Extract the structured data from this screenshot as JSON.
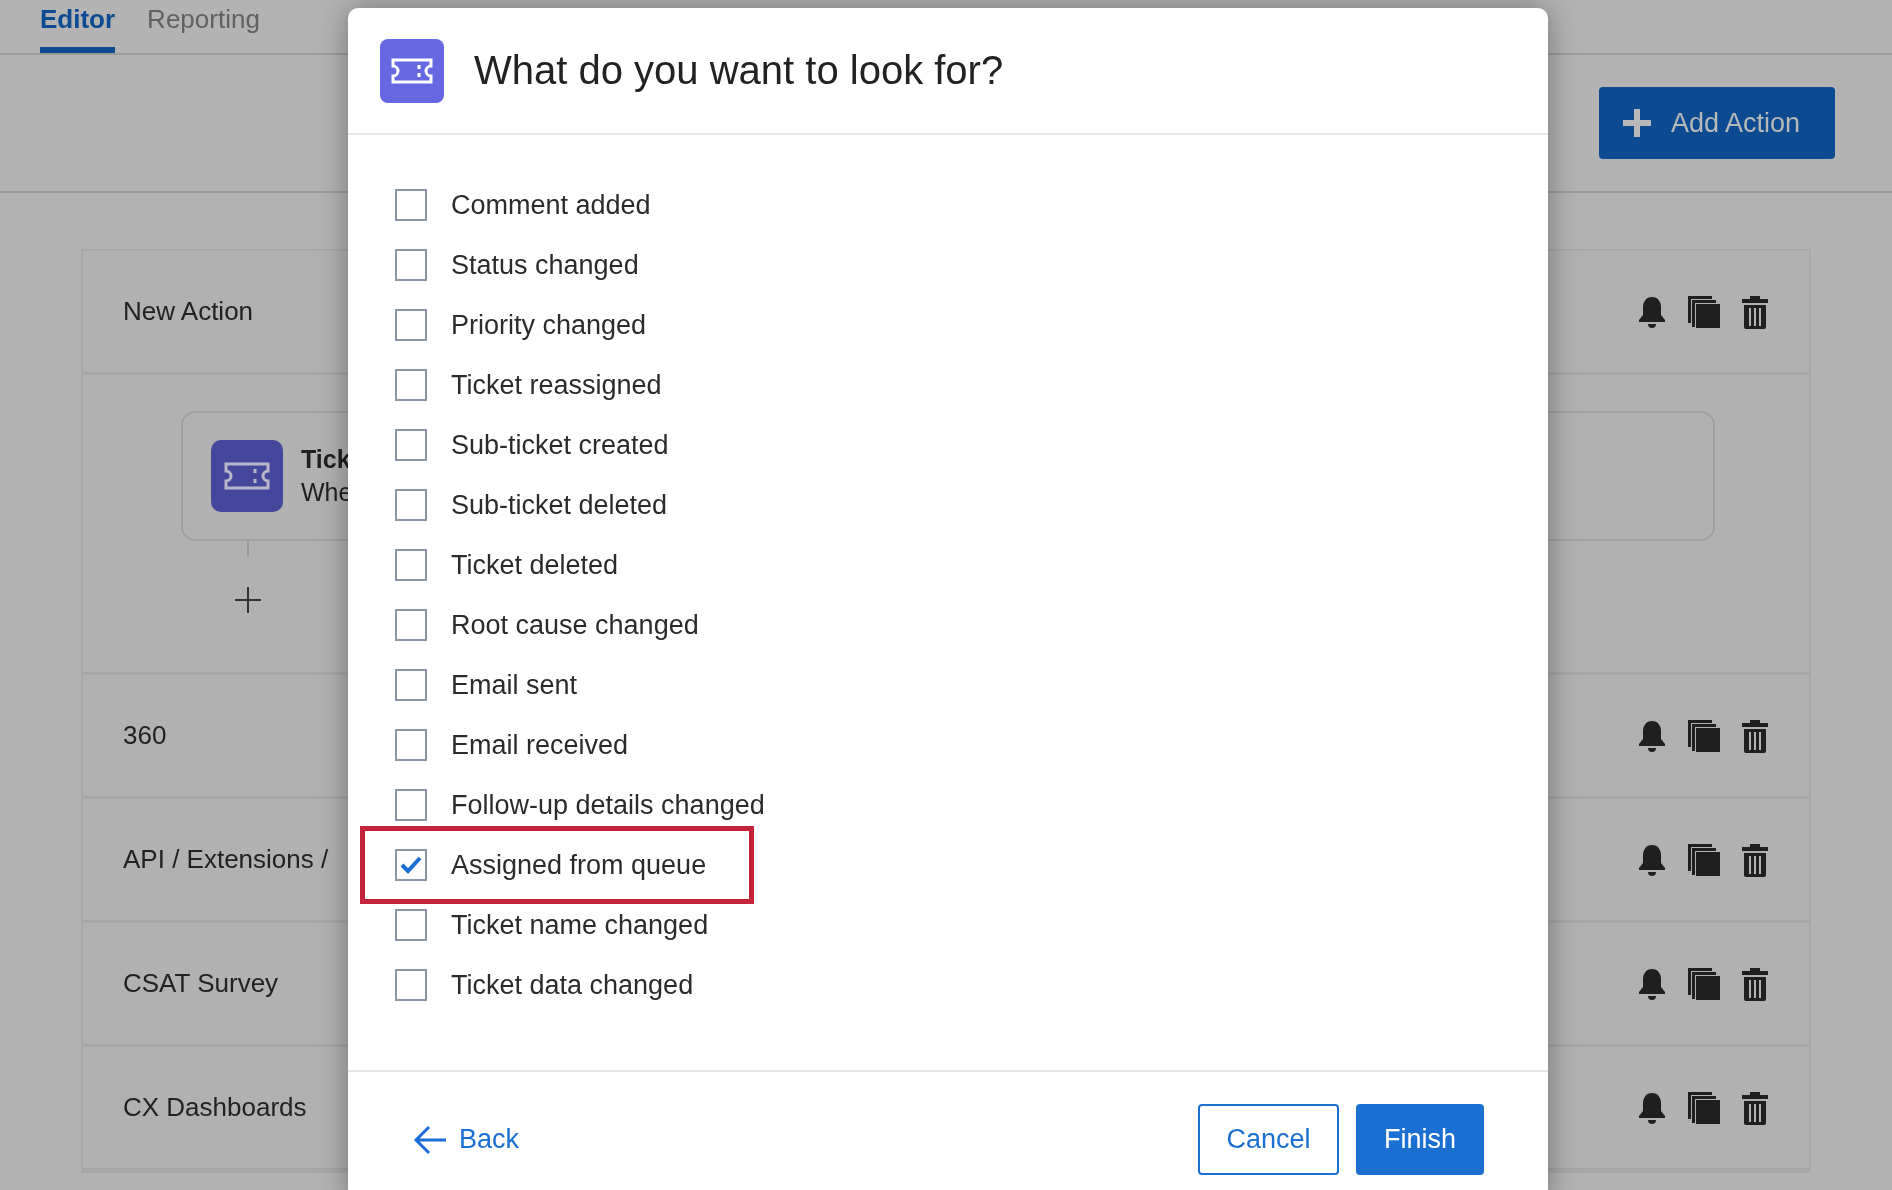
{
  "tabs": [
    {
      "label": "Editor",
      "selected": true
    },
    {
      "label": "Reporting",
      "selected": false
    }
  ],
  "add_action_button": {
    "label": "Add Action"
  },
  "actions": [
    {
      "title": "New Action",
      "expanded": true,
      "trigger": {
        "title": "Tick",
        "subtitle": "Whe"
      }
    },
    {
      "title": "360",
      "expanded": false
    },
    {
      "title": "API / Extensions /",
      "expanded": false
    },
    {
      "title": "CSAT Survey",
      "expanded": false
    },
    {
      "title": "CX Dashboards",
      "expanded": false
    }
  ],
  "dialog": {
    "title": "What do you want to look for?",
    "options": [
      {
        "label": "Comment added",
        "checked": false,
        "highlighted": false
      },
      {
        "label": "Status changed",
        "checked": false,
        "highlighted": false
      },
      {
        "label": "Priority changed",
        "checked": false,
        "highlighted": false
      },
      {
        "label": "Ticket reassigned",
        "checked": false,
        "highlighted": false
      },
      {
        "label": "Sub-ticket created",
        "checked": false,
        "highlighted": false
      },
      {
        "label": "Sub-ticket deleted",
        "checked": false,
        "highlighted": false
      },
      {
        "label": "Ticket deleted",
        "checked": false,
        "highlighted": false
      },
      {
        "label": "Root cause changed",
        "checked": false,
        "highlighted": false
      },
      {
        "label": "Email sent",
        "checked": false,
        "highlighted": false
      },
      {
        "label": "Email received",
        "checked": false,
        "highlighted": false
      },
      {
        "label": "Follow-up details changed",
        "checked": false,
        "highlighted": false
      },
      {
        "label": "Assigned from queue",
        "checked": true,
        "highlighted": true
      },
      {
        "label": "Ticket name changed",
        "checked": false,
        "highlighted": false
      },
      {
        "label": "Ticket data changed",
        "checked": false,
        "highlighted": false
      }
    ],
    "back": "Back",
    "cancel": "Cancel",
    "finish": "Finish"
  }
}
